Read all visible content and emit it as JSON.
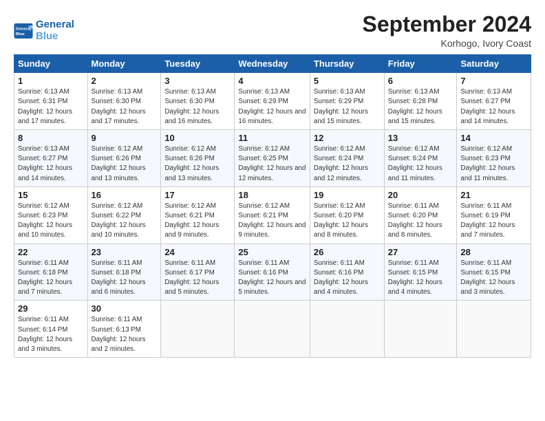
{
  "header": {
    "logo_line1": "General",
    "logo_line2": "Blue",
    "month": "September 2024",
    "location": "Korhogo, Ivory Coast"
  },
  "columns": [
    "Sunday",
    "Monday",
    "Tuesday",
    "Wednesday",
    "Thursday",
    "Friday",
    "Saturday"
  ],
  "weeks": [
    [
      {
        "day": "1",
        "sunrise": "6:13 AM",
        "sunset": "6:31 PM",
        "daylight": "12 hours and 17 minutes."
      },
      {
        "day": "2",
        "sunrise": "6:13 AM",
        "sunset": "6:30 PM",
        "daylight": "12 hours and 17 minutes."
      },
      {
        "day": "3",
        "sunrise": "6:13 AM",
        "sunset": "6:30 PM",
        "daylight": "12 hours and 16 minutes."
      },
      {
        "day": "4",
        "sunrise": "6:13 AM",
        "sunset": "6:29 PM",
        "daylight": "12 hours and 16 minutes."
      },
      {
        "day": "5",
        "sunrise": "6:13 AM",
        "sunset": "6:29 PM",
        "daylight": "12 hours and 15 minutes."
      },
      {
        "day": "6",
        "sunrise": "6:13 AM",
        "sunset": "6:28 PM",
        "daylight": "12 hours and 15 minutes."
      },
      {
        "day": "7",
        "sunrise": "6:13 AM",
        "sunset": "6:27 PM",
        "daylight": "12 hours and 14 minutes."
      }
    ],
    [
      {
        "day": "8",
        "sunrise": "6:13 AM",
        "sunset": "6:27 PM",
        "daylight": "12 hours and 14 minutes."
      },
      {
        "day": "9",
        "sunrise": "6:12 AM",
        "sunset": "6:26 PM",
        "daylight": "12 hours and 13 minutes."
      },
      {
        "day": "10",
        "sunrise": "6:12 AM",
        "sunset": "6:26 PM",
        "daylight": "12 hours and 13 minutes."
      },
      {
        "day": "11",
        "sunrise": "6:12 AM",
        "sunset": "6:25 PM",
        "daylight": "12 hours and 12 minutes."
      },
      {
        "day": "12",
        "sunrise": "6:12 AM",
        "sunset": "6:24 PM",
        "daylight": "12 hours and 12 minutes."
      },
      {
        "day": "13",
        "sunrise": "6:12 AM",
        "sunset": "6:24 PM",
        "daylight": "12 hours and 11 minutes."
      },
      {
        "day": "14",
        "sunrise": "6:12 AM",
        "sunset": "6:23 PM",
        "daylight": "12 hours and 11 minutes."
      }
    ],
    [
      {
        "day": "15",
        "sunrise": "6:12 AM",
        "sunset": "6:23 PM",
        "daylight": "12 hours and 10 minutes."
      },
      {
        "day": "16",
        "sunrise": "6:12 AM",
        "sunset": "6:22 PM",
        "daylight": "12 hours and 10 minutes."
      },
      {
        "day": "17",
        "sunrise": "6:12 AM",
        "sunset": "6:21 PM",
        "daylight": "12 hours and 9 minutes."
      },
      {
        "day": "18",
        "sunrise": "6:12 AM",
        "sunset": "6:21 PM",
        "daylight": "12 hours and 9 minutes."
      },
      {
        "day": "19",
        "sunrise": "6:12 AM",
        "sunset": "6:20 PM",
        "daylight": "12 hours and 8 minutes."
      },
      {
        "day": "20",
        "sunrise": "6:11 AM",
        "sunset": "6:20 PM",
        "daylight": "12 hours and 8 minutes."
      },
      {
        "day": "21",
        "sunrise": "6:11 AM",
        "sunset": "6:19 PM",
        "daylight": "12 hours and 7 minutes."
      }
    ],
    [
      {
        "day": "22",
        "sunrise": "6:11 AM",
        "sunset": "6:18 PM",
        "daylight": "12 hours and 7 minutes."
      },
      {
        "day": "23",
        "sunrise": "6:11 AM",
        "sunset": "6:18 PM",
        "daylight": "12 hours and 6 minutes."
      },
      {
        "day": "24",
        "sunrise": "6:11 AM",
        "sunset": "6:17 PM",
        "daylight": "12 hours and 5 minutes."
      },
      {
        "day": "25",
        "sunrise": "6:11 AM",
        "sunset": "6:16 PM",
        "daylight": "12 hours and 5 minutes."
      },
      {
        "day": "26",
        "sunrise": "6:11 AM",
        "sunset": "6:16 PM",
        "daylight": "12 hours and 4 minutes."
      },
      {
        "day": "27",
        "sunrise": "6:11 AM",
        "sunset": "6:15 PM",
        "daylight": "12 hours and 4 minutes."
      },
      {
        "day": "28",
        "sunrise": "6:11 AM",
        "sunset": "6:15 PM",
        "daylight": "12 hours and 3 minutes."
      }
    ],
    [
      {
        "day": "29",
        "sunrise": "6:11 AM",
        "sunset": "6:14 PM",
        "daylight": "12 hours and 3 minutes."
      },
      {
        "day": "30",
        "sunrise": "6:11 AM",
        "sunset": "6:13 PM",
        "daylight": "12 hours and 2 minutes."
      },
      null,
      null,
      null,
      null,
      null
    ]
  ]
}
